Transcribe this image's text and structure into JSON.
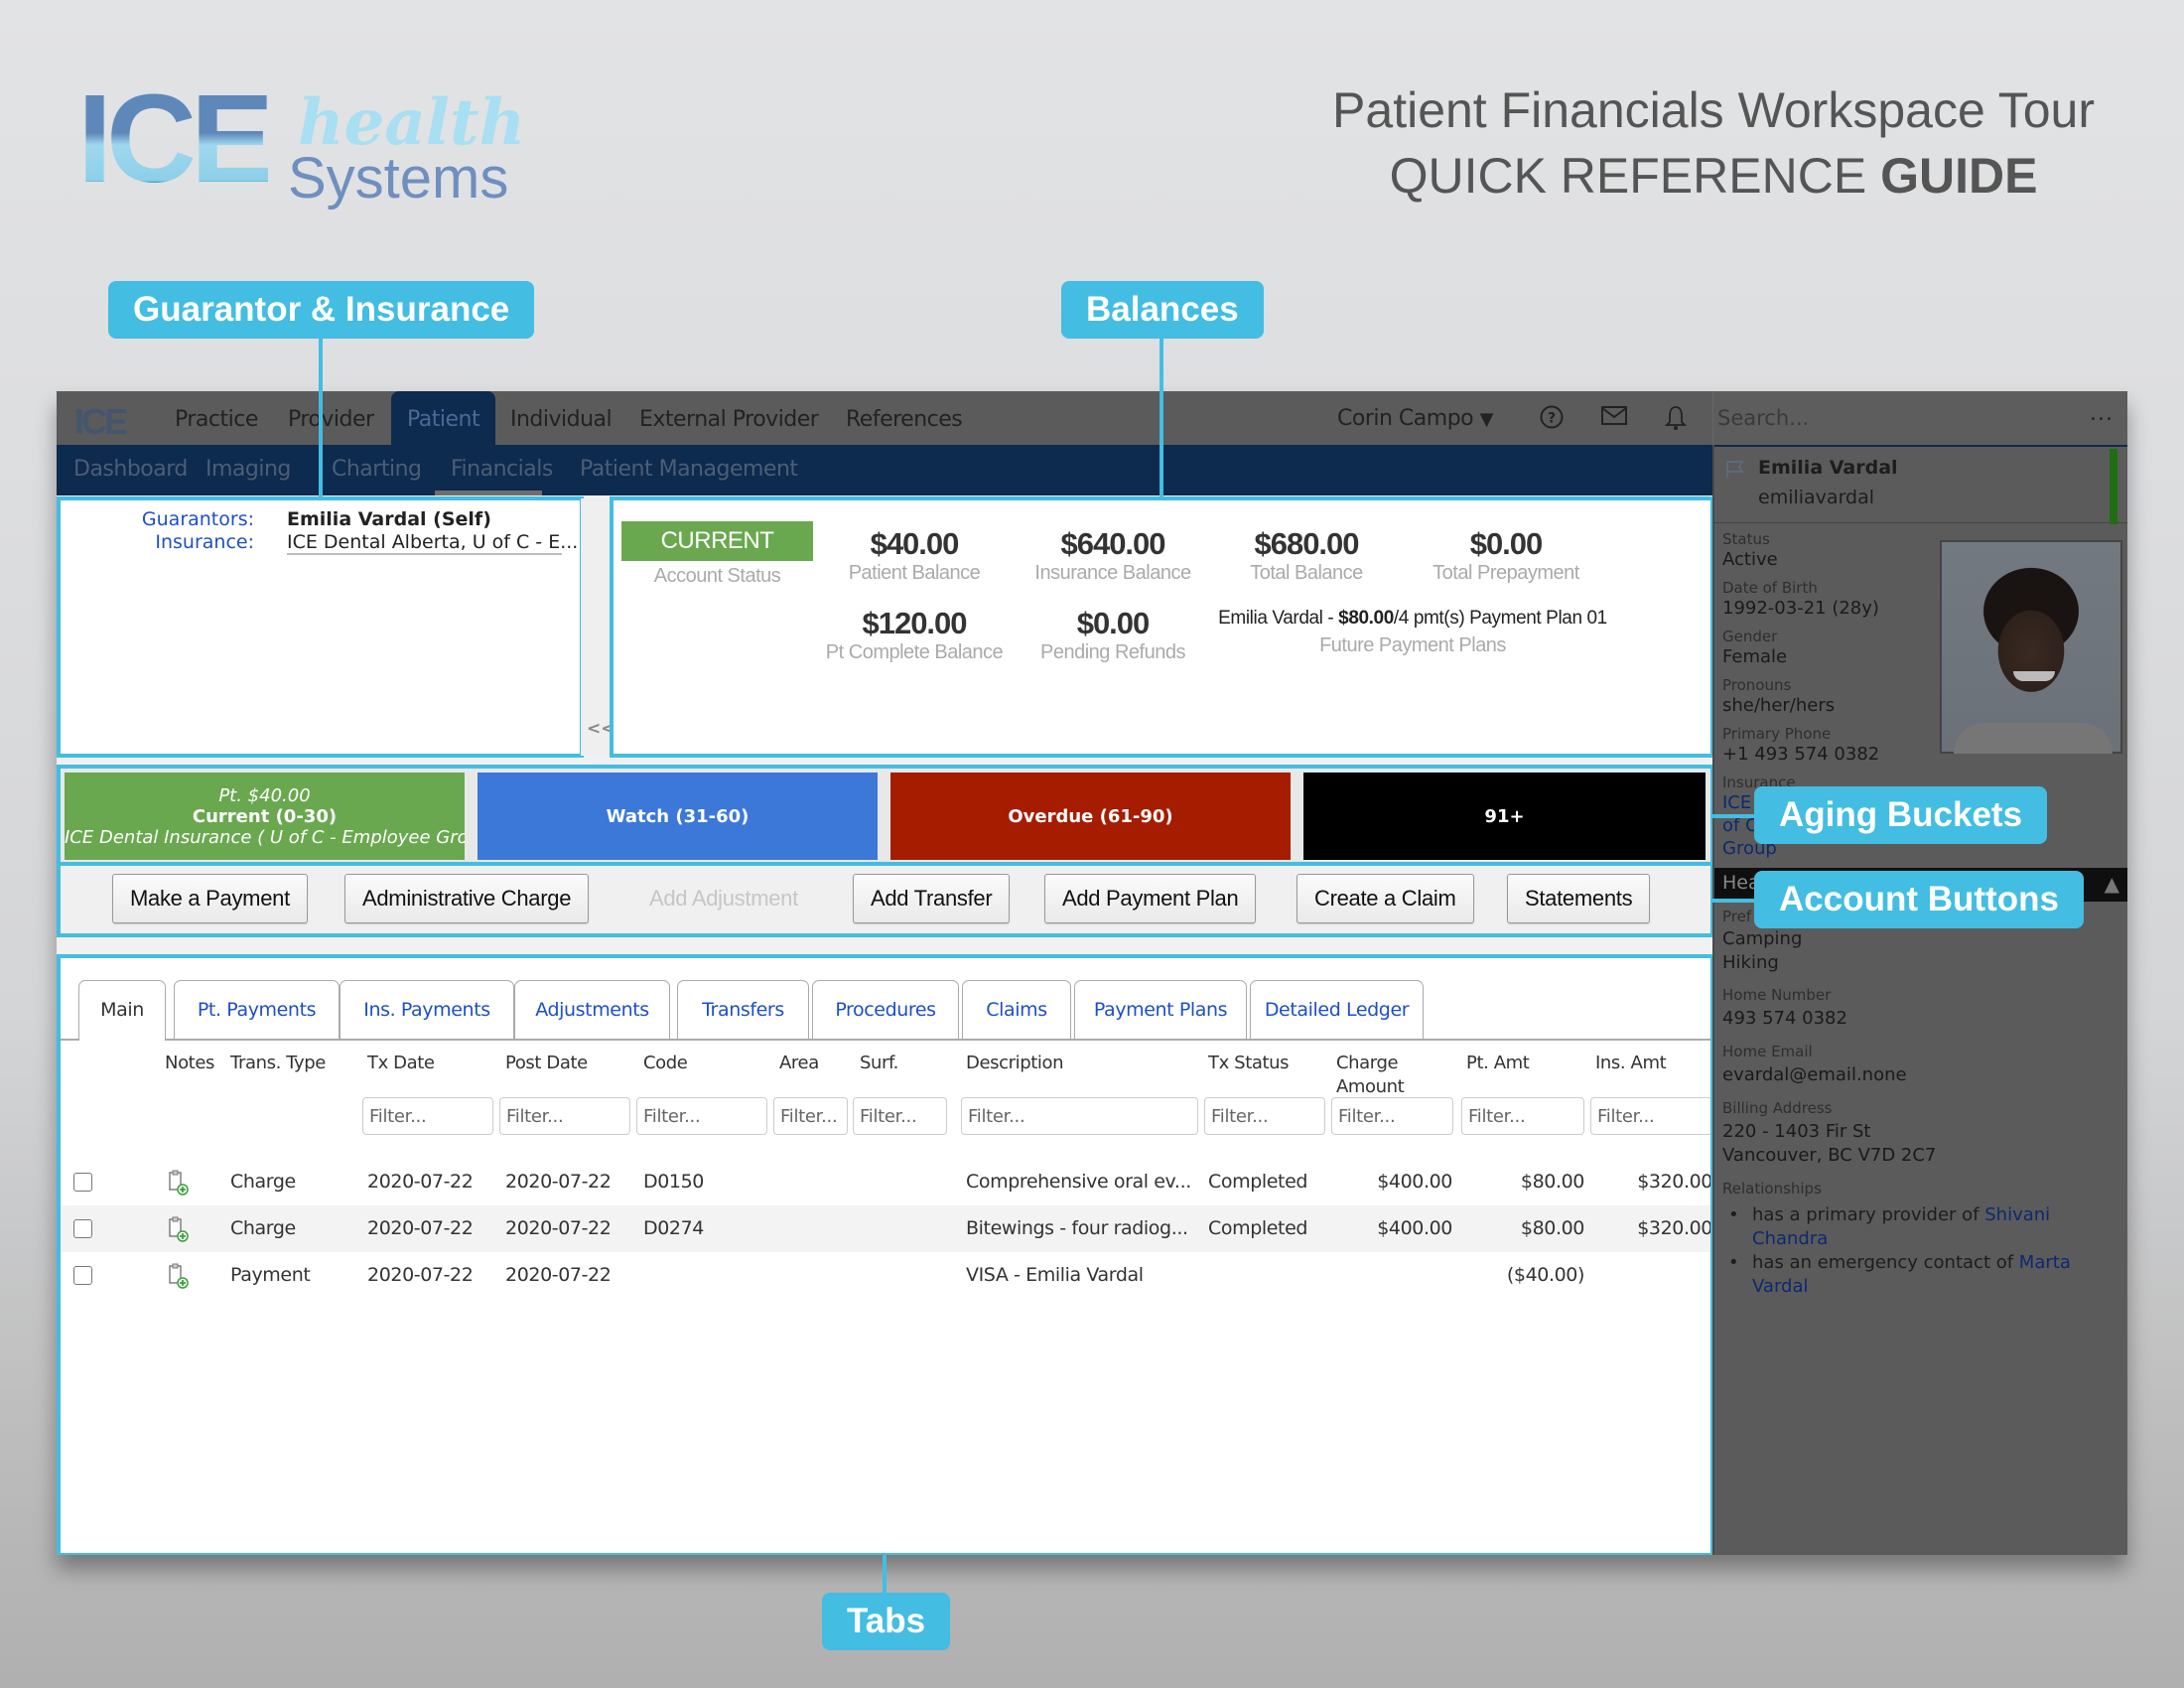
{
  "guide": {
    "brand_ice": "ICE",
    "brand_health": "health",
    "brand_systems": "Systems",
    "title_line1": "Patient Financials Workspace Tour",
    "title_line2_normal": "QUICK REFERENCE",
    "title_line2_bold": "GUIDE"
  },
  "callouts": {
    "guarantor": "Guarantor & Insurance",
    "balances": "Balances",
    "aging": "Aging Buckets",
    "account_buttons": "Account Buttons",
    "tabs": "Tabs"
  },
  "topbar": {
    "logo": "ICE",
    "nav": [
      "Practice",
      "Provider",
      "Patient",
      "Individual",
      "External Provider",
      "References"
    ],
    "active_nav": "Patient",
    "user_name": "Corin Campo",
    "search_placeholder": "Search...",
    "more": "..."
  },
  "subnav": {
    "items": [
      "Dashboard",
      "Imaging",
      "Charting",
      "Financials",
      "Patient Management"
    ],
    "active": "Financials"
  },
  "guarantor_panel": {
    "guarantors_label": "Guarantors:",
    "guarantors_value": "Emilia Vardal (Self)",
    "insurance_label": "Insurance:",
    "insurance_value": "ICE Dental Alberta, U of C - E...",
    "collapse": "<<"
  },
  "balances": {
    "account_status": "CURRENT",
    "account_status_label": "Account Status",
    "status_color": "#6aa84f",
    "patient_balance": "$40.00",
    "patient_balance_label": "Patient Balance",
    "insurance_balance": "$640.00",
    "insurance_balance_label": "Insurance Balance",
    "total_balance": "$680.00",
    "total_balance_label": "Total Balance",
    "total_prepayment": "$0.00",
    "total_prepayment_label": "Total Prepayment",
    "pt_complete_balance": "$120.00",
    "pt_complete_balance_label": "Pt Complete Balance",
    "pending_refunds": "$0.00",
    "pending_refunds_label": "Pending Refunds",
    "plan_name": "Emilia Vardal - ",
    "plan_amount": "$80.00",
    "plan_terms": "/4 pmt(s) Payment Plan 01",
    "future_plans_label": "Future Payment Plans"
  },
  "aging_buckets": [
    {
      "top": "Pt. $40.00",
      "label": "Current (0-30)",
      "bottom": "ICE Dental Insurance ( U of C - Employee Gro...",
      "color": "#6aa84f"
    },
    {
      "top": "",
      "label": "Watch (31-60)",
      "bottom": "",
      "color": "#3c78d8"
    },
    {
      "top": "",
      "label": "Overdue (61-90)",
      "bottom": "",
      "color": "#a61c00"
    },
    {
      "top": "",
      "label": "91+",
      "bottom": "",
      "color": "#000000"
    }
  ],
  "account_buttons": [
    {
      "label": "Make a Payment",
      "enabled": true
    },
    {
      "label": "Administrative Charge",
      "enabled": true
    },
    {
      "label": "Add Adjustment",
      "enabled": false
    },
    {
      "label": "Add Transfer",
      "enabled": true
    },
    {
      "label": "Add Payment Plan",
      "enabled": true
    },
    {
      "label": "Create a Claim",
      "enabled": true
    },
    {
      "label": "Statements",
      "enabled": true
    }
  ],
  "tabs": [
    "Main",
    "Pt. Payments",
    "Ins. Payments",
    "Adjustments",
    "Transfers",
    "Procedures",
    "Claims",
    "Payment Plans",
    "Detailed Ledger"
  ],
  "active_tab": "Main",
  "ledger": {
    "columns": [
      "Notes",
      "Trans. Type",
      "Tx Date",
      "Post Date",
      "Code",
      "Area",
      "Surf.",
      "Description",
      "Tx Status",
      "Charge Amount",
      "Pt. Amt",
      "Ins. Amt"
    ],
    "filter_placeholder": "Filter...",
    "rows": [
      {
        "type": "Charge",
        "tx_date": "2020-07-22",
        "post_date": "2020-07-22",
        "code": "D0150",
        "area": "",
        "surf": "",
        "description": "Comprehensive oral ev...",
        "status": "Completed",
        "charge": "$400.00",
        "pt_amt": "$80.00",
        "ins_amt": "$320.00"
      },
      {
        "type": "Charge",
        "tx_date": "2020-07-22",
        "post_date": "2020-07-22",
        "code": "D0274",
        "area": "",
        "surf": "",
        "description": "Bitewings - four radiog...",
        "status": "Completed",
        "charge": "$400.00",
        "pt_amt": "$80.00",
        "ins_amt": "$320.00"
      },
      {
        "type": "Payment",
        "tx_date": "2020-07-22",
        "post_date": "2020-07-22",
        "code": "",
        "area": "",
        "surf": "",
        "description": "VISA - Emilia Vardal",
        "status": "",
        "charge": "",
        "pt_amt": "($40.00)",
        "ins_amt": ""
      }
    ]
  },
  "patient_sidebar": {
    "name": "Emilia Vardal",
    "username": "emiliavardal",
    "status_label": "Status",
    "status": "Active",
    "dob_label": "Date of Birth",
    "dob": "1992-03-21 (28y)",
    "gender_label": "Gender",
    "gender": "Female",
    "pronouns_label": "Pronouns",
    "pronouns": "she/her/hers",
    "phone_label": "Primary Phone",
    "phone": "+1 493 574 0382",
    "insurance_label": "Insurance",
    "insurance_lines": [
      "ICE",
      "of C",
      "Group"
    ],
    "section_header": "Hea",
    "pref_label": "Pref",
    "preferences": [
      "Camping",
      "Hiking"
    ],
    "home_number_label": "Home Number",
    "home_number": "493 574 0382",
    "home_email_label": "Home Email",
    "home_email": "evardal@email.none",
    "billing_label": "Billing Address",
    "billing_line1": "220 - 1403 Fir St",
    "billing_line2": "Vancouver, BC V7D 2C7",
    "relationships_label": "Relationships",
    "relationships": [
      {
        "text": "has a primary provider of ",
        "link": "Shivani Chandra"
      },
      {
        "text": "has an emergency contact of ",
        "link": "Marta Vardal"
      }
    ]
  }
}
